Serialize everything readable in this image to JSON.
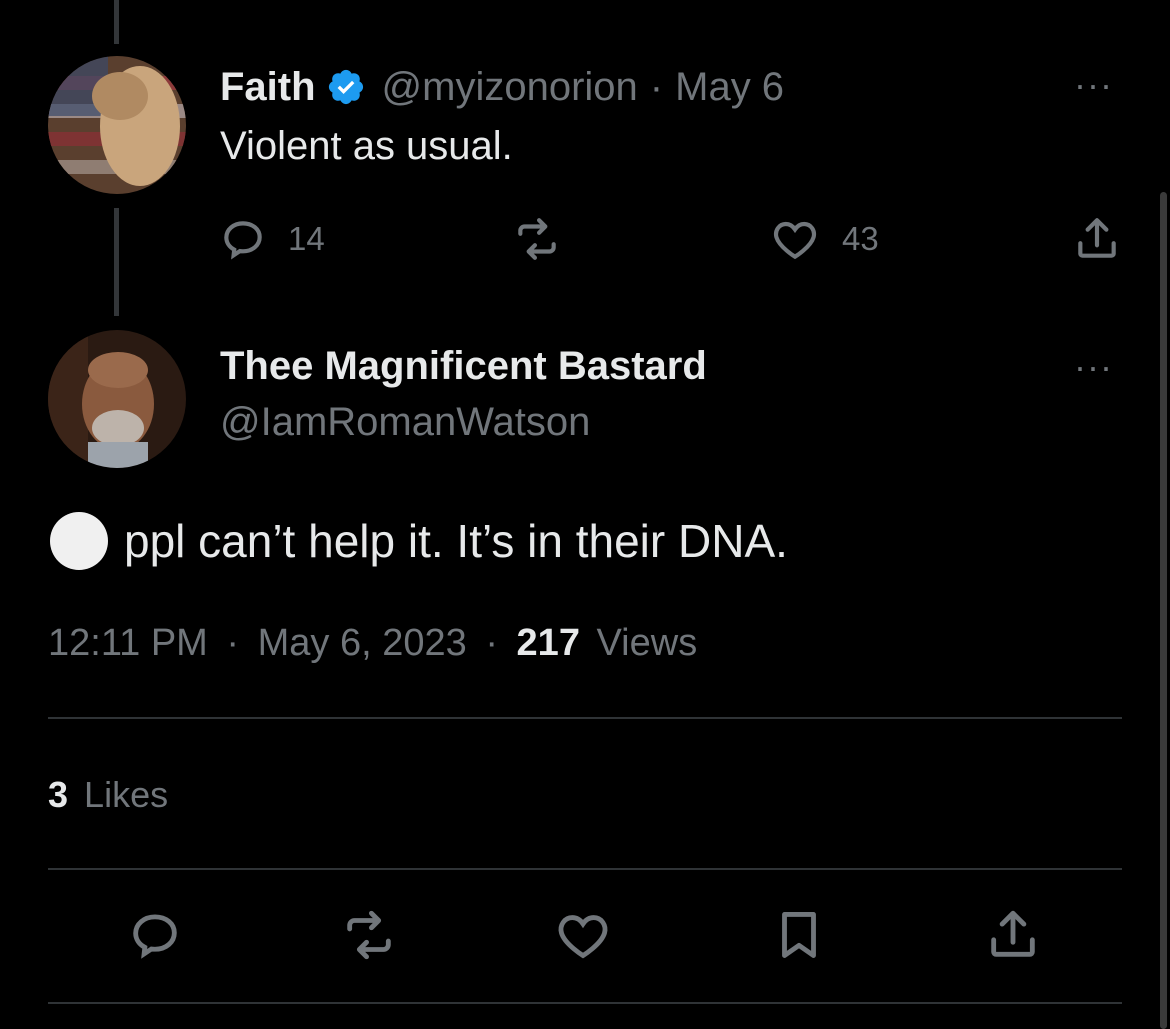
{
  "parent_tweet": {
    "display_name": "Faith",
    "handle": "@myizonorion",
    "separator": "·",
    "date": "May 6",
    "text": "Violent as usual.",
    "reply_count": "14",
    "like_count": "43",
    "more": "···"
  },
  "main_tweet": {
    "display_name": "Thee Magnificent Bastard",
    "handle": "@IamRomanWatson",
    "text": "ppl can’t help it. It’s in their DNA.",
    "time": "12:11 PM",
    "sep1": "·",
    "date": "May 6, 2023",
    "sep2": "·",
    "views_count": "217",
    "views_label": "Views",
    "likes_count": "3",
    "likes_label": "Likes",
    "more": "···"
  },
  "colors": {
    "background": "#000000",
    "text": "#e7e9ea",
    "muted": "#71767b",
    "verified": "#1d9bf0",
    "divider": "#2f3336"
  }
}
